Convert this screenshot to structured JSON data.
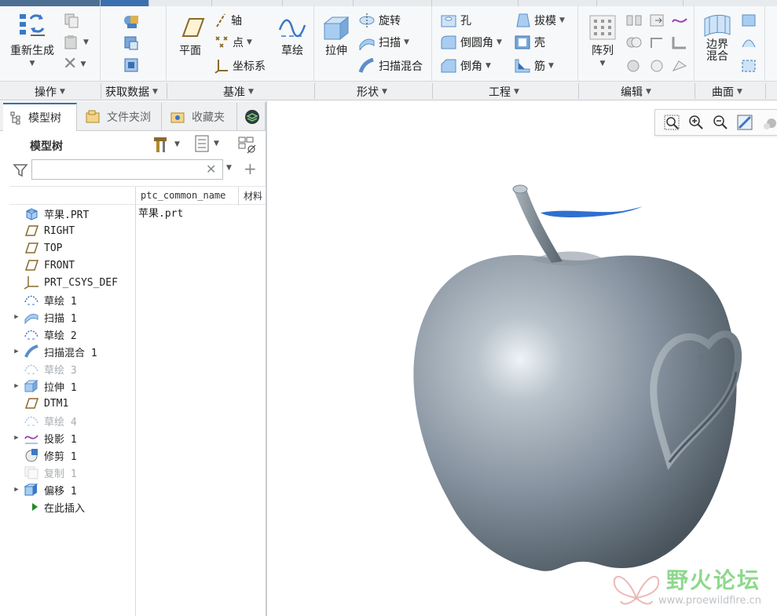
{
  "ribbon": {
    "groups": [
      {
        "label": "操作"
      },
      {
        "label": "获取数据"
      },
      {
        "label": "基准"
      },
      {
        "label": "形状"
      },
      {
        "label": "工程"
      },
      {
        "label": "编辑"
      },
      {
        "label": "曲面"
      }
    ],
    "buttons": {
      "regenerate": "重新生成",
      "plane": "平面",
      "axis": "轴",
      "point": "点",
      "csys": "坐标系",
      "sketch": "草绘",
      "extrude": "拉伸",
      "revolve": "旋转",
      "sweep": "扫描",
      "swept_blend": "扫描混合",
      "hole": "孔",
      "round": "倒圆角",
      "chamfer": "倒角",
      "draft": "拔模",
      "shell": "壳",
      "rib": "筋",
      "pattern": "阵列",
      "boundary_blend": "边界\n混合"
    }
  },
  "left_panel": {
    "tabs": [
      {
        "label": "模型树"
      },
      {
        "label": "文件夹浏"
      },
      {
        "label": "收藏夹"
      }
    ],
    "tree_title": "模型树",
    "search_placeholder": "",
    "columns": [
      "ptc_common_name",
      "材料"
    ],
    "root_value": "苹果.prt",
    "tree_items": [
      {
        "label": "苹果.PRT",
        "icon": "part-icon",
        "expand": false,
        "dim": false
      },
      {
        "label": "RIGHT",
        "icon": "datum-plane-icon",
        "expand": false,
        "dim": false
      },
      {
        "label": "TOP",
        "icon": "datum-plane-icon",
        "expand": false,
        "dim": false
      },
      {
        "label": "FRONT",
        "icon": "datum-plane-icon",
        "expand": false,
        "dim": false
      },
      {
        "label": "PRT_CSYS_DEF",
        "icon": "csys-icon",
        "expand": false,
        "dim": false
      },
      {
        "label": "草绘 1",
        "icon": "sketch-icon",
        "expand": false,
        "dim": false
      },
      {
        "label": "扫描 1",
        "icon": "sweep-icon",
        "expand": true,
        "dim": false
      },
      {
        "label": "草绘 2",
        "icon": "sketch-icon",
        "expand": false,
        "dim": false
      },
      {
        "label": "扫描混合 1",
        "icon": "swept-blend-icon",
        "expand": true,
        "dim": false
      },
      {
        "label": "草绘 3",
        "icon": "sketch-icon",
        "expand": false,
        "dim": true
      },
      {
        "label": "拉伸 1",
        "icon": "extrude-icon",
        "expand": true,
        "dim": false
      },
      {
        "label": "DTM1",
        "icon": "datum-plane-icon",
        "expand": false,
        "dim": false
      },
      {
        "label": "草绘 4",
        "icon": "sketch-icon",
        "expand": false,
        "dim": true
      },
      {
        "label": "投影 1",
        "icon": "project-icon",
        "expand": true,
        "dim": false
      },
      {
        "label": "修剪 1",
        "icon": "trim-icon",
        "expand": false,
        "dim": false
      },
      {
        "label": "复制 1",
        "icon": "copy-icon",
        "expand": false,
        "dim": true
      },
      {
        "label": "偏移 1",
        "icon": "offset-icon",
        "expand": true,
        "dim": false
      },
      {
        "label": "在此插入",
        "icon": "insert-arrow-icon",
        "expand": false,
        "dim": false
      }
    ]
  },
  "watermark": {
    "brand": "野火论坛",
    "url": "www.proewildfire.cn"
  },
  "colors": {
    "accent": "#3a6fb0",
    "apple_body": "#7e8a93",
    "leaf": "#2f6fd0",
    "watermark_green": "#7bd27b"
  }
}
